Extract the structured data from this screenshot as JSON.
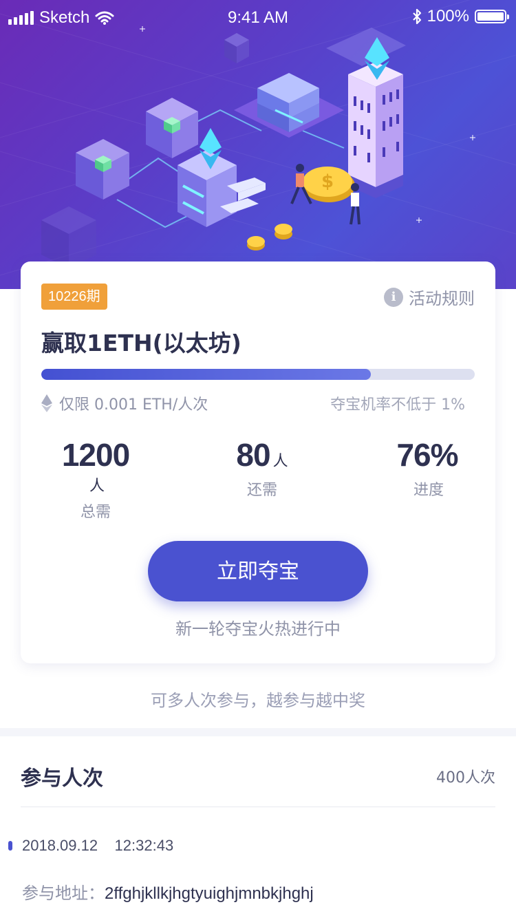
{
  "status_bar": {
    "carrier": "Sketch",
    "time": "9:41 AM",
    "battery": "100%"
  },
  "card": {
    "period_badge": "10226期",
    "rules_label": "活动规则",
    "title": "赢取1ETH(以太坊)",
    "progress": 0.76,
    "limit_text": "仅限 0.001 ETH/人次",
    "rate_text": "夺宝机率不低于 1%",
    "stats": [
      {
        "value": "1200",
        "unit": "人",
        "label": "总需"
      },
      {
        "value": "80",
        "unit": "人",
        "label": "还需"
      },
      {
        "value": "76%",
        "unit": "",
        "label": "进度"
      }
    ],
    "cta_label": "立即夺宝",
    "subtitle": "新一轮夺宝火热进行中"
  },
  "note": "可多人次参与，越参与越中奖",
  "participants": {
    "title": "参与人次",
    "count": "400人次",
    "records": [
      {
        "time": "2018.09.12    12:32:43",
        "address_label": "参与地址：",
        "address": "2ffghjkllkjhgtyuighjmnbkjhghj"
      }
    ]
  },
  "colors": {
    "accent": "#4a52d0",
    "badge": "#f0a03a",
    "hero_start": "#6a2bb7",
    "hero_end": "#4d52d6"
  },
  "icons": [
    "signal-icon",
    "wifi-icon",
    "bluetooth-icon",
    "battery-icon",
    "info-icon",
    "eth-icon"
  ]
}
